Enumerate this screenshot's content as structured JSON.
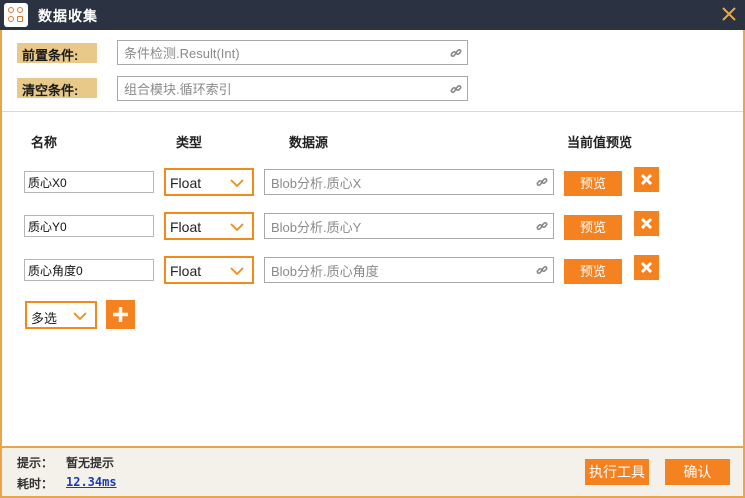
{
  "window": {
    "title": "数据收集"
  },
  "conditions": {
    "pre": {
      "label": "前置条件:",
      "placeholder": "条件检测.Result(Int)"
    },
    "clear": {
      "label": "清空条件:",
      "placeholder": "组合模块.循环索引"
    }
  },
  "columns": {
    "name": "名称",
    "type": "类型",
    "source": "数据源",
    "preview": "当前值预览"
  },
  "rows": [
    {
      "name": "质心X0",
      "type": "Float",
      "source": "Blob分析.质心X",
      "preview_label": "预览"
    },
    {
      "name": "质心Y0",
      "type": "Float",
      "source": "Blob分析.质心Y",
      "preview_label": "预览"
    },
    {
      "name": "质心角度0",
      "type": "Float",
      "source": "Blob分析.质心角度",
      "preview_label": "预览"
    }
  ],
  "multi_select": {
    "value": "多选"
  },
  "footer": {
    "hint_label": "提示：",
    "hint_value": "暂无提示",
    "time_label": "耗时：",
    "time_value": "12.34ms",
    "run_button": "执行工具",
    "confirm_button": "确认"
  },
  "colors": {
    "accent": "#f58220",
    "titlebar": "#2b3241",
    "label_bg": "#e8c98a",
    "border": "#e8a64a"
  },
  "icons": [
    "app-icon",
    "close-icon",
    "link-icon",
    "chevron-down-icon",
    "delete-icon",
    "plus-icon"
  ]
}
